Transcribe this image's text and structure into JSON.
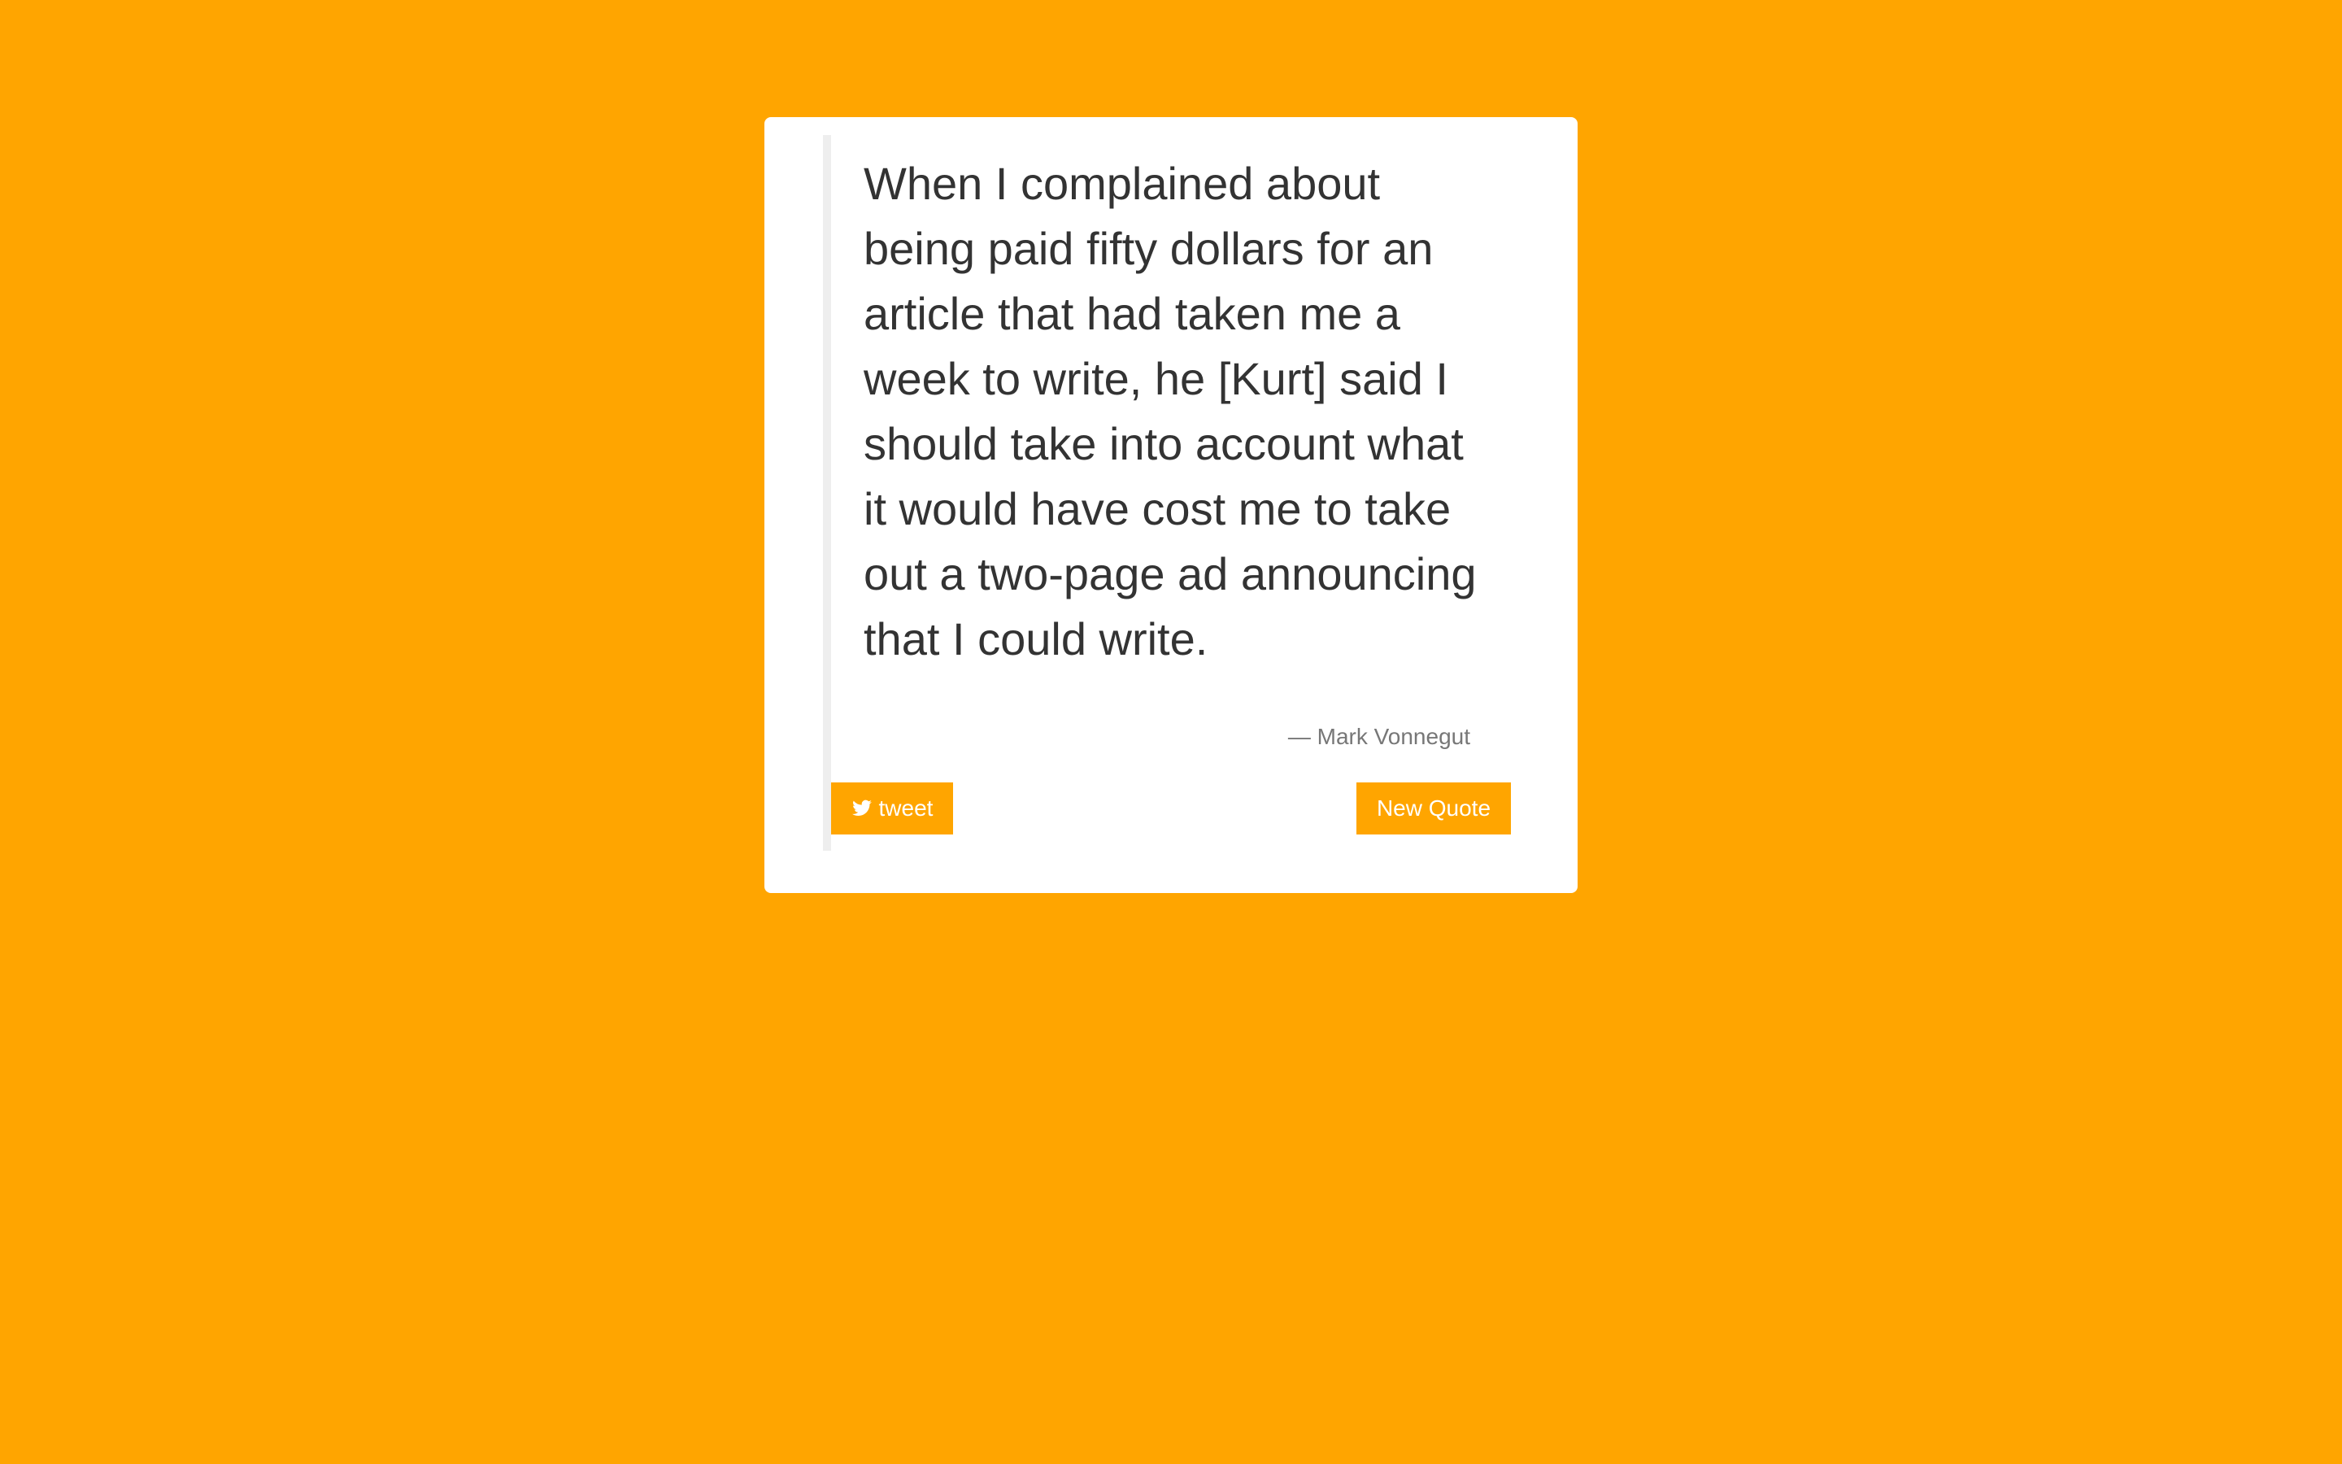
{
  "page": {
    "background_color": "#FFA500",
    "card_color": "#ffffff"
  },
  "quote": {
    "text": "When I complained about being paid fifty dollars for an article that had taken me a week to write, he [Kurt] said I should take into account what it would have cost me to take out a two-page ad announcing that I could write.",
    "author": "— Mark Vonnegut"
  },
  "actions": {
    "tweet_icon": "twitter-icon",
    "tweet_label": "tweet",
    "new_quote_label": "New Quote"
  }
}
